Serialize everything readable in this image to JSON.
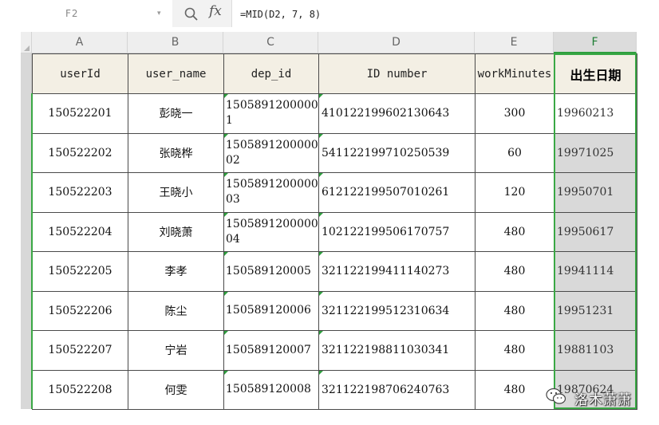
{
  "formula_bar": {
    "cell_ref": "F2",
    "formula": "=MID(D2, 7, 8)",
    "fx_label": "fx"
  },
  "columns": [
    "A",
    "B",
    "C",
    "D",
    "E",
    "F"
  ],
  "headers": [
    "userId",
    "user_name",
    "dep_id",
    "ID number",
    "workMinutes",
    "出生日期"
  ],
  "rows": [
    [
      "150522201",
      "彭晓一",
      "1505891200000 1",
      "410122199602130643",
      "300",
      "19960213"
    ],
    [
      "150522202",
      "张晓桦",
      "1505891200000 02",
      "541122199710250539",
      "60",
      "19971025"
    ],
    [
      "150522203",
      "王晓小",
      "1505891200000 03",
      "612122199507010261",
      "120",
      "19950701"
    ],
    [
      "150522204",
      "刘晓萧",
      "1505891200000 04",
      "102122199506170757",
      "480",
      "19950617"
    ],
    [
      "150522205",
      "李孝",
      "150589120005",
      "321122199411140273",
      "480",
      "19941114"
    ],
    [
      "150522206",
      "陈尘",
      "150589120006",
      "321122199512310634",
      "480",
      "19951231"
    ],
    [
      "150522207",
      "宁岩",
      "150589120007",
      "321122198811030341",
      "480",
      "19881103"
    ],
    [
      "150522208",
      "何雯",
      "150589120008",
      "321122198706240763",
      "480",
      "19870624"
    ]
  ],
  "watermark": {
    "text": "洛木萧萧",
    "icon": "wechat-icon"
  },
  "colors": {
    "accent": "#3aa845",
    "header_bg": "#f3efe4",
    "filled_bg": "#d9d9d9"
  }
}
